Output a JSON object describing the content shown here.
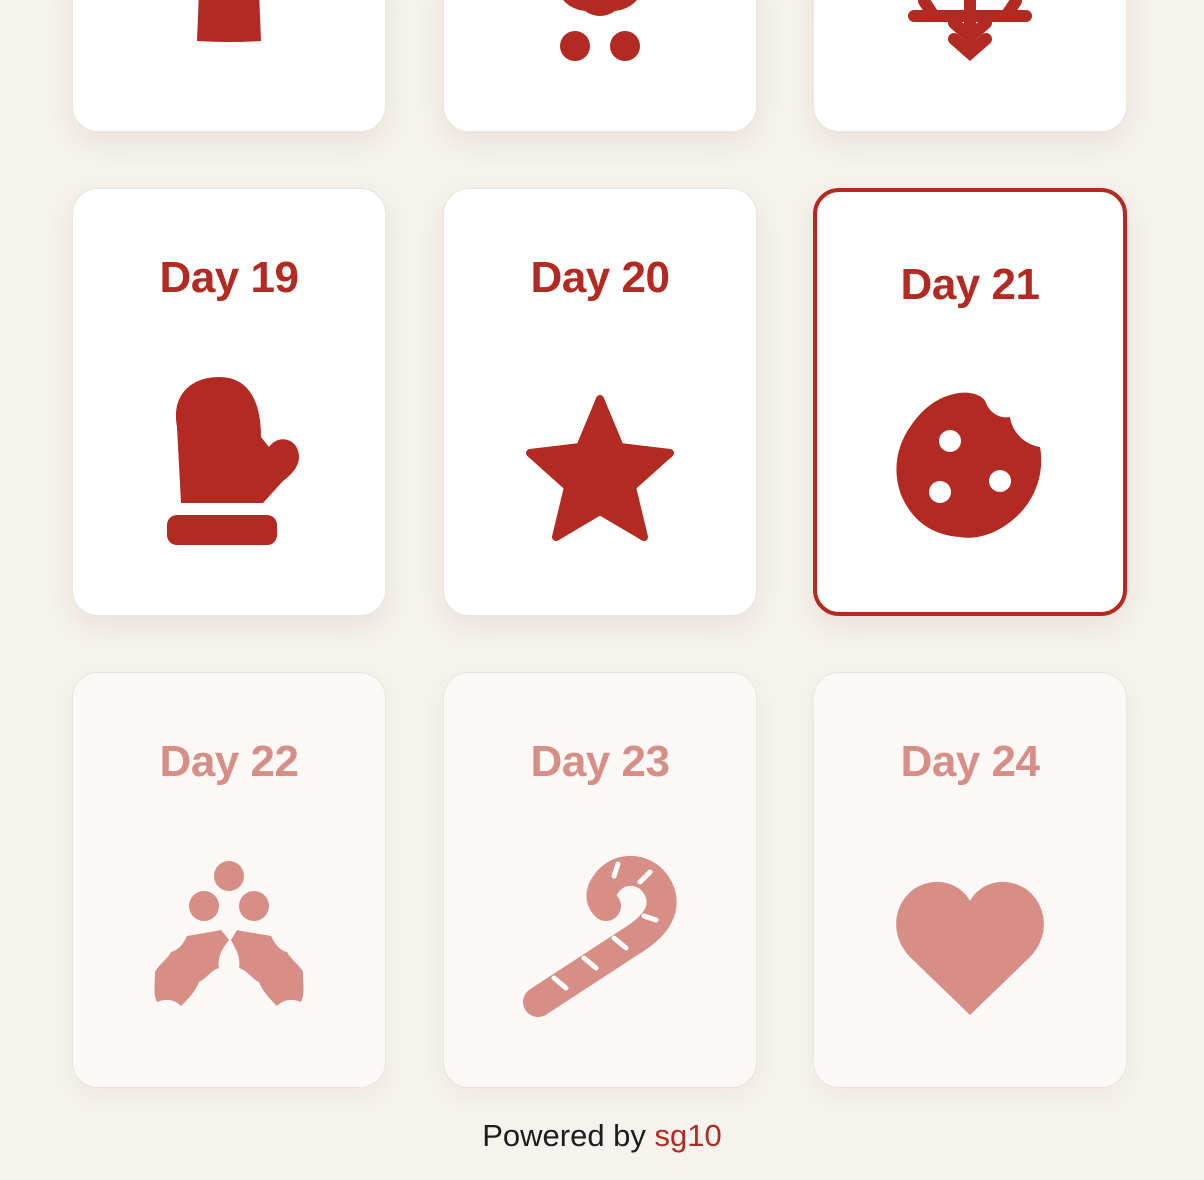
{
  "calendar": {
    "accent_color": "#b22a21",
    "locked_color": "#d68e87",
    "top_row": [
      {
        "icon": "ornament-icon"
      },
      {
        "icon": "sleigh-icon"
      },
      {
        "icon": "snowflake-icon"
      }
    ],
    "days": [
      {
        "label": "Day 19",
        "icon": "mitten-icon",
        "state": "open"
      },
      {
        "label": "Day 20",
        "icon": "star-icon",
        "state": "open"
      },
      {
        "label": "Day 21",
        "icon": "cookie-icon",
        "state": "today"
      },
      {
        "label": "Day 22",
        "icon": "holly-icon",
        "state": "locked"
      },
      {
        "label": "Day 23",
        "icon": "candy-cane-icon",
        "state": "locked"
      },
      {
        "label": "Day 24",
        "icon": "heart-icon",
        "state": "locked"
      }
    ]
  },
  "footer": {
    "prefix": "Powered by",
    "link_text": "sg10"
  }
}
